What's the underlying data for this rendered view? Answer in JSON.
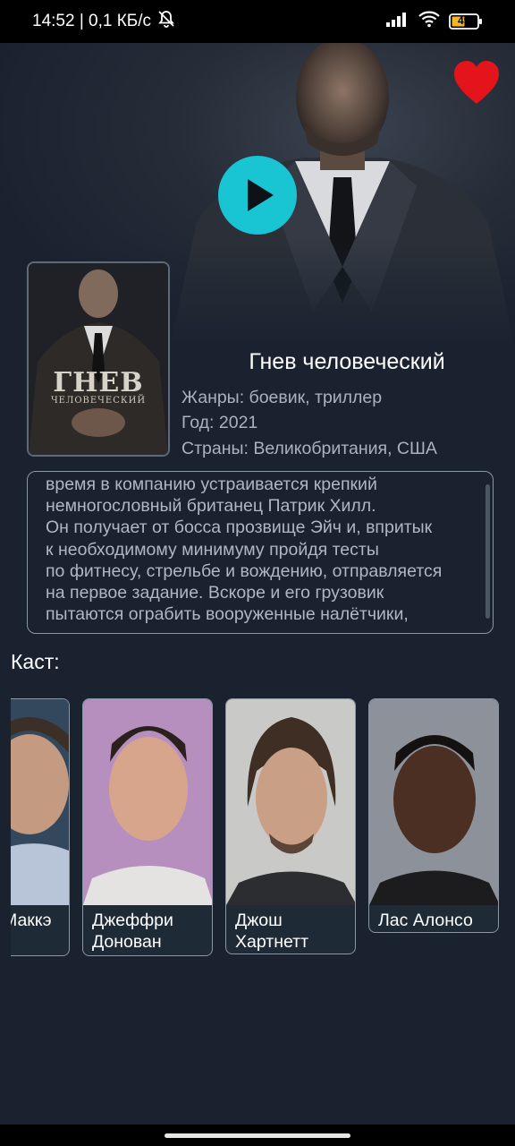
{
  "status_bar": {
    "time_speed": "14:52 | 0,1 КБ/с",
    "battery": "49"
  },
  "movie": {
    "title": "Гнев человеческий",
    "poster_title": "ГНЕВ",
    "poster_subtitle": "ЧЕЛОВЕЧЕСКИЙ",
    "genres": "Жанры: боевик, триллер",
    "year": "Год: 2021",
    "countries": "Страны: Великобритания, США",
    "description": "время в компанию устраивается крепкий\nнемногословный британец Патрик Хилл.\nОн получает от босса прозвище Эйч и, впритык\nк необходимому минимуму пройдя тесты\nпо фитнесу, стрельбе и вождению, отправляется\nна первое задание. Вскоре и его грузовик\nпытаются ограбить вооруженные налётчики,"
  },
  "cast": {
    "label": "Каст:",
    "members": [
      {
        "name": "Маккэ"
      },
      {
        "name": "Джеффри\nДонован"
      },
      {
        "name": "Джош\nХартнетт"
      },
      {
        "name": "Лас Алонсо"
      }
    ]
  },
  "icons": {
    "heart": "heart-icon",
    "play": "play-icon"
  },
  "colors": {
    "background": "#1a2230",
    "accent_play": "#19c5d2",
    "heart": "#e4141b"
  }
}
